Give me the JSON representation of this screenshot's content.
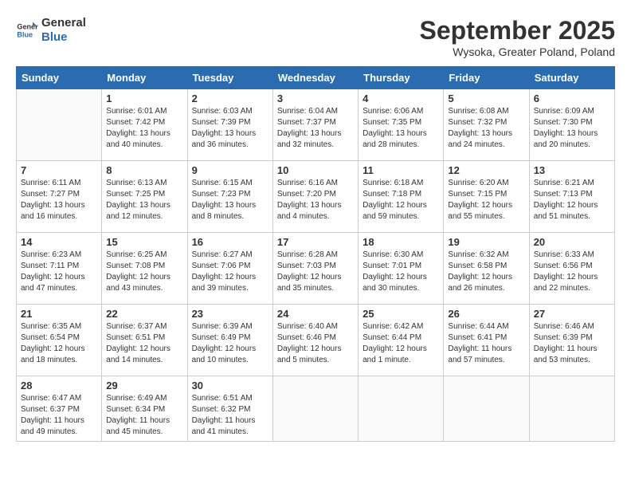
{
  "header": {
    "logo_line1": "General",
    "logo_line2": "Blue",
    "month": "September 2025",
    "location": "Wysoka, Greater Poland, Poland"
  },
  "weekdays": [
    "Sunday",
    "Monday",
    "Tuesday",
    "Wednesday",
    "Thursday",
    "Friday",
    "Saturday"
  ],
  "weeks": [
    [
      {
        "day": "",
        "info": ""
      },
      {
        "day": "1",
        "info": "Sunrise: 6:01 AM\nSunset: 7:42 PM\nDaylight: 13 hours\nand 40 minutes."
      },
      {
        "day": "2",
        "info": "Sunrise: 6:03 AM\nSunset: 7:39 PM\nDaylight: 13 hours\nand 36 minutes."
      },
      {
        "day": "3",
        "info": "Sunrise: 6:04 AM\nSunset: 7:37 PM\nDaylight: 13 hours\nand 32 minutes."
      },
      {
        "day": "4",
        "info": "Sunrise: 6:06 AM\nSunset: 7:35 PM\nDaylight: 13 hours\nand 28 minutes."
      },
      {
        "day": "5",
        "info": "Sunrise: 6:08 AM\nSunset: 7:32 PM\nDaylight: 13 hours\nand 24 minutes."
      },
      {
        "day": "6",
        "info": "Sunrise: 6:09 AM\nSunset: 7:30 PM\nDaylight: 13 hours\nand 20 minutes."
      }
    ],
    [
      {
        "day": "7",
        "info": "Sunrise: 6:11 AM\nSunset: 7:27 PM\nDaylight: 13 hours\nand 16 minutes."
      },
      {
        "day": "8",
        "info": "Sunrise: 6:13 AM\nSunset: 7:25 PM\nDaylight: 13 hours\nand 12 minutes."
      },
      {
        "day": "9",
        "info": "Sunrise: 6:15 AM\nSunset: 7:23 PM\nDaylight: 13 hours\nand 8 minutes."
      },
      {
        "day": "10",
        "info": "Sunrise: 6:16 AM\nSunset: 7:20 PM\nDaylight: 13 hours\nand 4 minutes."
      },
      {
        "day": "11",
        "info": "Sunrise: 6:18 AM\nSunset: 7:18 PM\nDaylight: 12 hours\nand 59 minutes."
      },
      {
        "day": "12",
        "info": "Sunrise: 6:20 AM\nSunset: 7:15 PM\nDaylight: 12 hours\nand 55 minutes."
      },
      {
        "day": "13",
        "info": "Sunrise: 6:21 AM\nSunset: 7:13 PM\nDaylight: 12 hours\nand 51 minutes."
      }
    ],
    [
      {
        "day": "14",
        "info": "Sunrise: 6:23 AM\nSunset: 7:11 PM\nDaylight: 12 hours\nand 47 minutes."
      },
      {
        "day": "15",
        "info": "Sunrise: 6:25 AM\nSunset: 7:08 PM\nDaylight: 12 hours\nand 43 minutes."
      },
      {
        "day": "16",
        "info": "Sunrise: 6:27 AM\nSunset: 7:06 PM\nDaylight: 12 hours\nand 39 minutes."
      },
      {
        "day": "17",
        "info": "Sunrise: 6:28 AM\nSunset: 7:03 PM\nDaylight: 12 hours\nand 35 minutes."
      },
      {
        "day": "18",
        "info": "Sunrise: 6:30 AM\nSunset: 7:01 PM\nDaylight: 12 hours\nand 30 minutes."
      },
      {
        "day": "19",
        "info": "Sunrise: 6:32 AM\nSunset: 6:58 PM\nDaylight: 12 hours\nand 26 minutes."
      },
      {
        "day": "20",
        "info": "Sunrise: 6:33 AM\nSunset: 6:56 PM\nDaylight: 12 hours\nand 22 minutes."
      }
    ],
    [
      {
        "day": "21",
        "info": "Sunrise: 6:35 AM\nSunset: 6:54 PM\nDaylight: 12 hours\nand 18 minutes."
      },
      {
        "day": "22",
        "info": "Sunrise: 6:37 AM\nSunset: 6:51 PM\nDaylight: 12 hours\nand 14 minutes."
      },
      {
        "day": "23",
        "info": "Sunrise: 6:39 AM\nSunset: 6:49 PM\nDaylight: 12 hours\nand 10 minutes."
      },
      {
        "day": "24",
        "info": "Sunrise: 6:40 AM\nSunset: 6:46 PM\nDaylight: 12 hours\nand 5 minutes."
      },
      {
        "day": "25",
        "info": "Sunrise: 6:42 AM\nSunset: 6:44 PM\nDaylight: 12 hours\nand 1 minute."
      },
      {
        "day": "26",
        "info": "Sunrise: 6:44 AM\nSunset: 6:41 PM\nDaylight: 11 hours\nand 57 minutes."
      },
      {
        "day": "27",
        "info": "Sunrise: 6:46 AM\nSunset: 6:39 PM\nDaylight: 11 hours\nand 53 minutes."
      }
    ],
    [
      {
        "day": "28",
        "info": "Sunrise: 6:47 AM\nSunset: 6:37 PM\nDaylight: 11 hours\nand 49 minutes."
      },
      {
        "day": "29",
        "info": "Sunrise: 6:49 AM\nSunset: 6:34 PM\nDaylight: 11 hours\nand 45 minutes."
      },
      {
        "day": "30",
        "info": "Sunrise: 6:51 AM\nSunset: 6:32 PM\nDaylight: 11 hours\nand 41 minutes."
      },
      {
        "day": "",
        "info": ""
      },
      {
        "day": "",
        "info": ""
      },
      {
        "day": "",
        "info": ""
      },
      {
        "day": "",
        "info": ""
      }
    ]
  ]
}
